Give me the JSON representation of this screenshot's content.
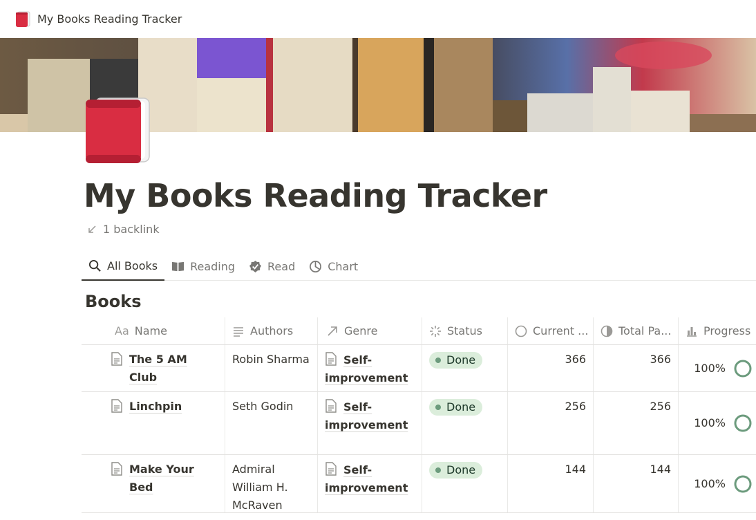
{
  "breadcrumb": {
    "title": "My Books Reading Tracker",
    "icon": "red-book-icon"
  },
  "page": {
    "title": "My Books Reading Tracker",
    "backlink": "1 backlink"
  },
  "tabs": [
    {
      "label": "All Books",
      "icon": "search-icon",
      "active": true
    },
    {
      "label": "Reading",
      "icon": "open-book-icon",
      "active": false
    },
    {
      "label": "Read",
      "icon": "check-badge-icon",
      "active": false
    },
    {
      "label": "Chart",
      "icon": "pie-chart-icon",
      "active": false
    }
  ],
  "database": {
    "title": "Books",
    "columns": [
      {
        "label": "Name",
        "icon": "text-type-icon"
      },
      {
        "label": "Authors",
        "icon": "lines-icon"
      },
      {
        "label": "Genre",
        "icon": "relation-arrow-icon"
      },
      {
        "label": "Status",
        "icon": "status-icon"
      },
      {
        "label": "Current ...",
        "icon": "circle-icon"
      },
      {
        "label": "Total Pa...",
        "icon": "half-circle-icon"
      },
      {
        "label": "Progress",
        "icon": "bar-chart-icon"
      }
    ],
    "rows": [
      {
        "name": "The 5 AM Club",
        "authors": "Robin Sharma",
        "genre": "Self-improvement",
        "status": "Done",
        "current": "366",
        "total": "366",
        "progress": "100%",
        "progress_value": 1.0
      },
      {
        "name": "Linchpin",
        "authors": "Seth Godin",
        "genre": "Self-improvement",
        "status": "Done",
        "current": "256",
        "total": "256",
        "progress": "100%",
        "progress_value": 1.0
      },
      {
        "name": "Make Your Bed",
        "authors": "Admiral William H. McRaven",
        "genre": "Self-improvement",
        "status": "Done",
        "current": "144",
        "total": "144",
        "progress": "100%",
        "progress_value": 1.0
      }
    ]
  },
  "colors": {
    "status_done_bg": "#dbeddb",
    "status_done_dot": "#6c9b7d",
    "progress_ring": "#6c9b7d",
    "book_red": "#d92d42"
  }
}
